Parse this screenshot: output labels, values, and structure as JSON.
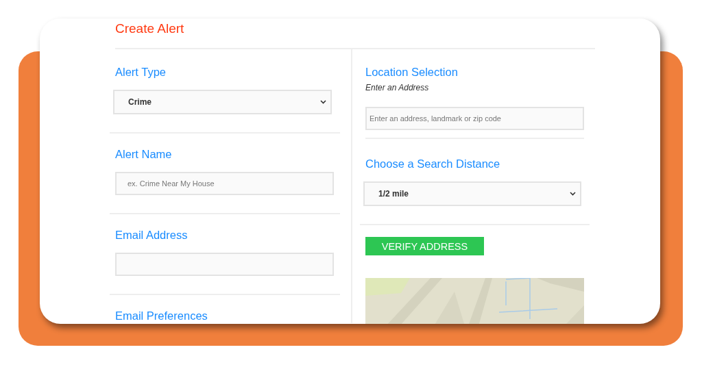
{
  "title": "Create Alert",
  "left_sections": [
    {
      "label": "Alert Type",
      "kind": "select",
      "value": "Crime"
    },
    {
      "label": "Alert Name",
      "kind": "text",
      "placeholder": "ex. Crime Near My House"
    },
    {
      "label": "Email Address",
      "kind": "text"
    },
    {
      "label": "Email Preferences",
      "kind": "heading"
    }
  ],
  "location": {
    "label": "Location Selection",
    "hint": "Enter an Address",
    "placeholder": "Enter an address, landmark or zip code"
  },
  "distance": {
    "label": "Choose a Search Distance",
    "value": "1/2 mile"
  },
  "verify_button": "VERIFY ADDRESS"
}
